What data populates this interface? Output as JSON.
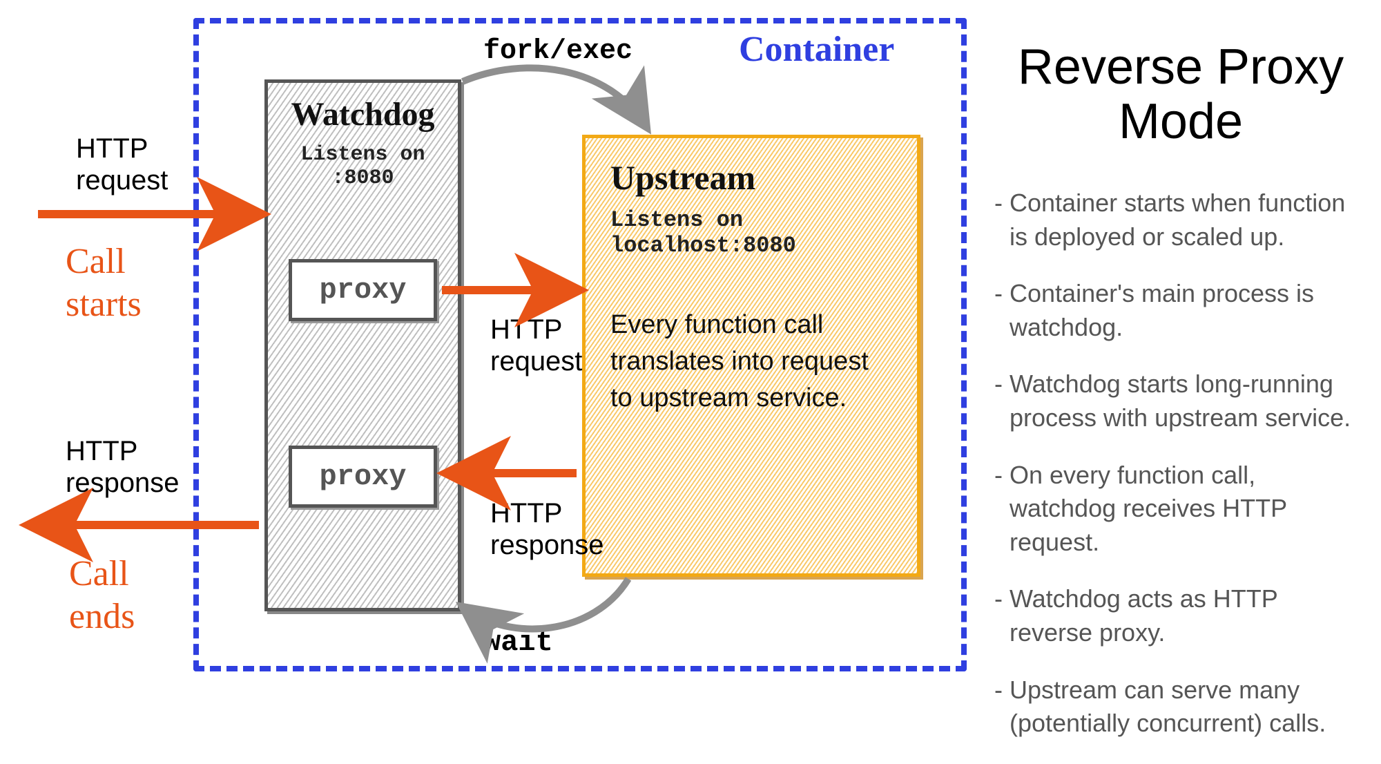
{
  "title": "Reverse Proxy\nMode",
  "container": {
    "label": "Container"
  },
  "watchdog": {
    "title": "Watchdog",
    "listens": "Listens on\n:8080",
    "proxy1": "proxy",
    "proxy2": "proxy"
  },
  "upstream": {
    "title": "Upstream",
    "listens": "Listens on\nlocalhost:8080",
    "body": "Every function call translates into request to upstream service."
  },
  "labels": {
    "http_request_in": "HTTP\nrequest",
    "call_starts": "Call\nstarts",
    "fork_exec": "fork/exec",
    "http_request_mid": "HTTP\nrequest",
    "http_response_mid": "HTTP\nresponse",
    "http_response_out": "HTTP\nresponse",
    "call_ends": "Call\nends",
    "wait": "wait"
  },
  "bullets": [
    "Container starts when function is deployed or scaled up.",
    "Container's main process is watchdog.",
    "Watchdog starts long-running process with upstream service.",
    "On every function call, watchdog receives HTTP request.",
    "Watchdog acts as HTTP reverse proxy.",
    "Upstream can serve many (potentially concurrent) calls."
  ],
  "colors": {
    "orange": "#e85417",
    "blue": "#2f3fe0",
    "gray": "#8f8f8f",
    "amber": "#f2a915"
  }
}
